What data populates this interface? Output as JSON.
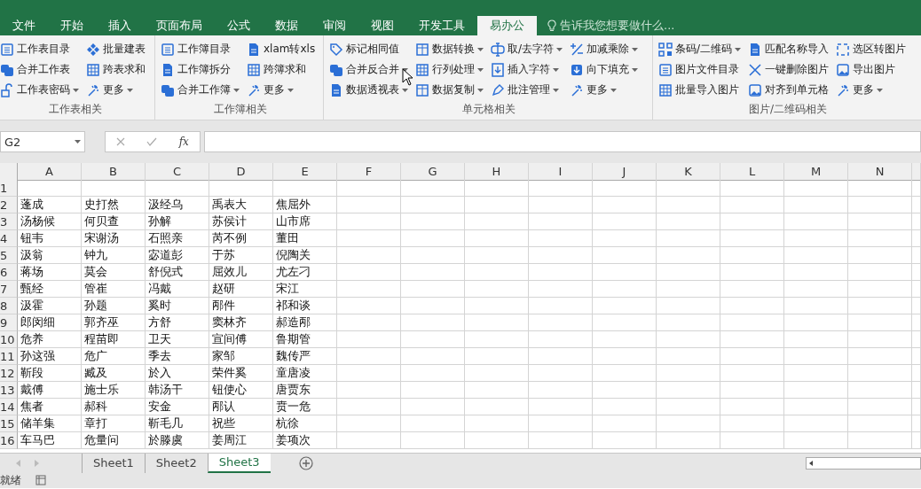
{
  "ribbon_tabs": [
    {
      "label": "文件",
      "selected": false
    },
    {
      "label": "开始",
      "selected": false
    },
    {
      "label": "插入",
      "selected": false
    },
    {
      "label": "页面布局",
      "selected": false
    },
    {
      "label": "公式",
      "selected": false
    },
    {
      "label": "数据",
      "selected": false
    },
    {
      "label": "审阅",
      "selected": false
    },
    {
      "label": "视图",
      "selected": false
    },
    {
      "label": "开发工具",
      "selected": false
    },
    {
      "label": "易办公",
      "selected": true
    }
  ],
  "tell_me": {
    "placeholder": "告诉我您想要做什么..."
  },
  "ribbon_groups": [
    {
      "label": "工作表相关",
      "columns": [
        [
          {
            "label": "工作表目录",
            "dropdown": false
          },
          {
            "label": "合并工作表",
            "dropdown": false
          },
          {
            "label": "工作表密码",
            "dropdown": true
          }
        ],
        [
          {
            "label": "批量建表",
            "dropdown": false
          },
          {
            "label": "跨表求和",
            "dropdown": false
          },
          {
            "label": "更多",
            "dropdown": true
          }
        ]
      ]
    },
    {
      "label": "工作簿相关",
      "columns": [
        [
          {
            "label": "工作簿目录",
            "dropdown": false
          },
          {
            "label": "工作簿拆分",
            "dropdown": false
          },
          {
            "label": "合并工作簿",
            "dropdown": true
          }
        ],
        [
          {
            "label": "xlam转xls",
            "dropdown": false
          },
          {
            "label": "跨簿求和",
            "dropdown": false
          },
          {
            "label": "更多",
            "dropdown": true
          }
        ]
      ]
    },
    {
      "label": "单元格相关",
      "columns": [
        [
          {
            "label": "标记相同值",
            "dropdown": false
          },
          {
            "label": "合并反合并",
            "dropdown": true
          },
          {
            "label": "数据透视表",
            "dropdown": true
          }
        ],
        [
          {
            "label": "数据转换",
            "dropdown": true
          },
          {
            "label": "行列处理",
            "dropdown": true
          },
          {
            "label": "数据复制",
            "dropdown": true
          }
        ],
        [
          {
            "label": "取/去字符",
            "dropdown": true
          },
          {
            "label": "插入字符",
            "dropdown": true
          },
          {
            "label": "批注管理",
            "dropdown": true
          }
        ],
        [
          {
            "label": "加减乘除",
            "dropdown": true
          },
          {
            "label": "向下填充",
            "dropdown": true
          },
          {
            "label": "更多",
            "dropdown": true
          }
        ]
      ]
    },
    {
      "label": "图片/二维码相关",
      "columns": [
        [
          {
            "label": "条码/二维码",
            "dropdown": true
          },
          {
            "label": "图片文件目录",
            "dropdown": false
          },
          {
            "label": "批量导入图片",
            "dropdown": false
          }
        ],
        [
          {
            "label": "匹配名称导入",
            "dropdown": false
          },
          {
            "label": "一键删除图片",
            "dropdown": false
          },
          {
            "label": "对齐到单元格",
            "dropdown": false
          }
        ],
        [
          {
            "label": "选区转图片",
            "dropdown": false
          },
          {
            "label": "导出图片",
            "dropdown": false
          },
          {
            "label": "更多",
            "dropdown": true
          }
        ]
      ]
    }
  ],
  "formula_bar": {
    "name_box": "G2",
    "function_label": "fx"
  },
  "grid": {
    "columns": [
      "A",
      "B",
      "C",
      "D",
      "E",
      "F",
      "G",
      "H",
      "I",
      "J",
      "K",
      "L",
      "M",
      "N"
    ],
    "rows": [
      {
        "header": "1",
        "cells": []
      },
      {
        "header": "2",
        "cells": [
          "蓬成",
          "史打然",
          "汲经乌",
          "禹表大",
          "焦屈外"
        ]
      },
      {
        "header": "3",
        "cells": [
          "汤杨候",
          "何贝查",
          "孙解",
          "苏侯计",
          "山市席"
        ]
      },
      {
        "header": "4",
        "cells": [
          "钮韦",
          "宋谢汤",
          "石照亲",
          "芮不例",
          "董田"
        ]
      },
      {
        "header": "5",
        "cells": [
          "汲翁",
          "钟九",
          "宓道彭",
          "于苏",
          "倪陶关"
        ]
      },
      {
        "header": "6",
        "cells": [
          "蒋场",
          "莫会",
          "舒倪式",
          "屈效儿",
          "尤左刁"
        ]
      },
      {
        "header": "7",
        "cells": [
          "甄经",
          "管崔",
          "冯戴",
          "赵研",
          "宋江"
        ]
      },
      {
        "header": "8",
        "cells": [
          "汲霍",
          "孙题",
          "奚时",
          "邴件",
          "祁和谈"
        ]
      },
      {
        "header": "9",
        "cells": [
          "郎闵细",
          "郭齐巫",
          "方舒",
          "窦林齐",
          "郝造邴"
        ]
      },
      {
        "header": "10",
        "cells": [
          "危养",
          "程苗即",
          "卫天",
          "宣间傅",
          "鲁期管"
        ]
      },
      {
        "header": "11",
        "cells": [
          "孙这强",
          "危广",
          "季去",
          "家邹",
          "魏传严"
        ]
      },
      {
        "header": "12",
        "cells": [
          "靳段",
          "臧及",
          "於入",
          "荣件奚",
          "童唐凌"
        ]
      },
      {
        "header": "13",
        "cells": [
          "戴傅",
          "施士乐",
          "韩汤干",
          "钮使心",
          "唐贾东"
        ]
      },
      {
        "header": "14",
        "cells": [
          "焦者",
          "郝科",
          "安金",
          "邴认",
          "贲一危"
        ]
      },
      {
        "header": "15",
        "cells": [
          "储羊集",
          "章打",
          "靳毛几",
          "祝些",
          "杭徐"
        ]
      },
      {
        "header": "16",
        "cells": [
          "车马巴",
          "危量问",
          "於滕虞",
          "姜周江",
          "姜项次"
        ]
      }
    ]
  },
  "sheet_tabs": [
    {
      "label": "Sheet1",
      "selected": false
    },
    {
      "label": "Sheet2",
      "selected": false
    },
    {
      "label": "Sheet3",
      "selected": true
    }
  ],
  "status_bar": {
    "text": "就绪"
  }
}
